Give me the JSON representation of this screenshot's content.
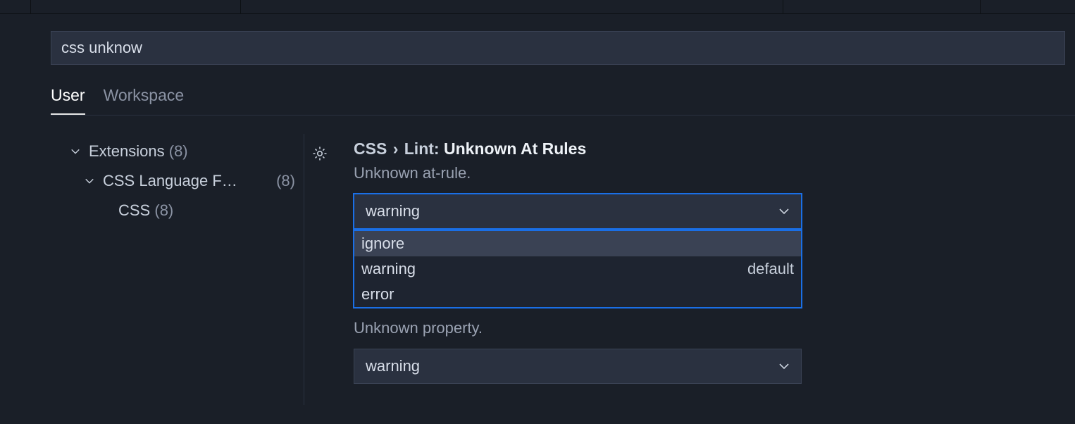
{
  "search": {
    "value": "css unknow"
  },
  "scopeTabs": {
    "user": "User",
    "workspace": "Workspace"
  },
  "tree": {
    "extensions": {
      "label": "Extensions",
      "count": "(8)"
    },
    "cssLang": {
      "label": "CSS Language F…",
      "count": "(8)"
    },
    "css": {
      "label": "CSS",
      "count": "(8)"
    }
  },
  "setting1": {
    "crumb1": "CSS",
    "crumb2": "Lint:",
    "name": "Unknown At Rules",
    "desc": "Unknown at-rule.",
    "value": "warning",
    "options": {
      "ignore": "ignore",
      "warning": "warning",
      "error": "error",
      "defaultBadge": "default"
    }
  },
  "setting2": {
    "desc": "Unknown property.",
    "value": "warning"
  }
}
